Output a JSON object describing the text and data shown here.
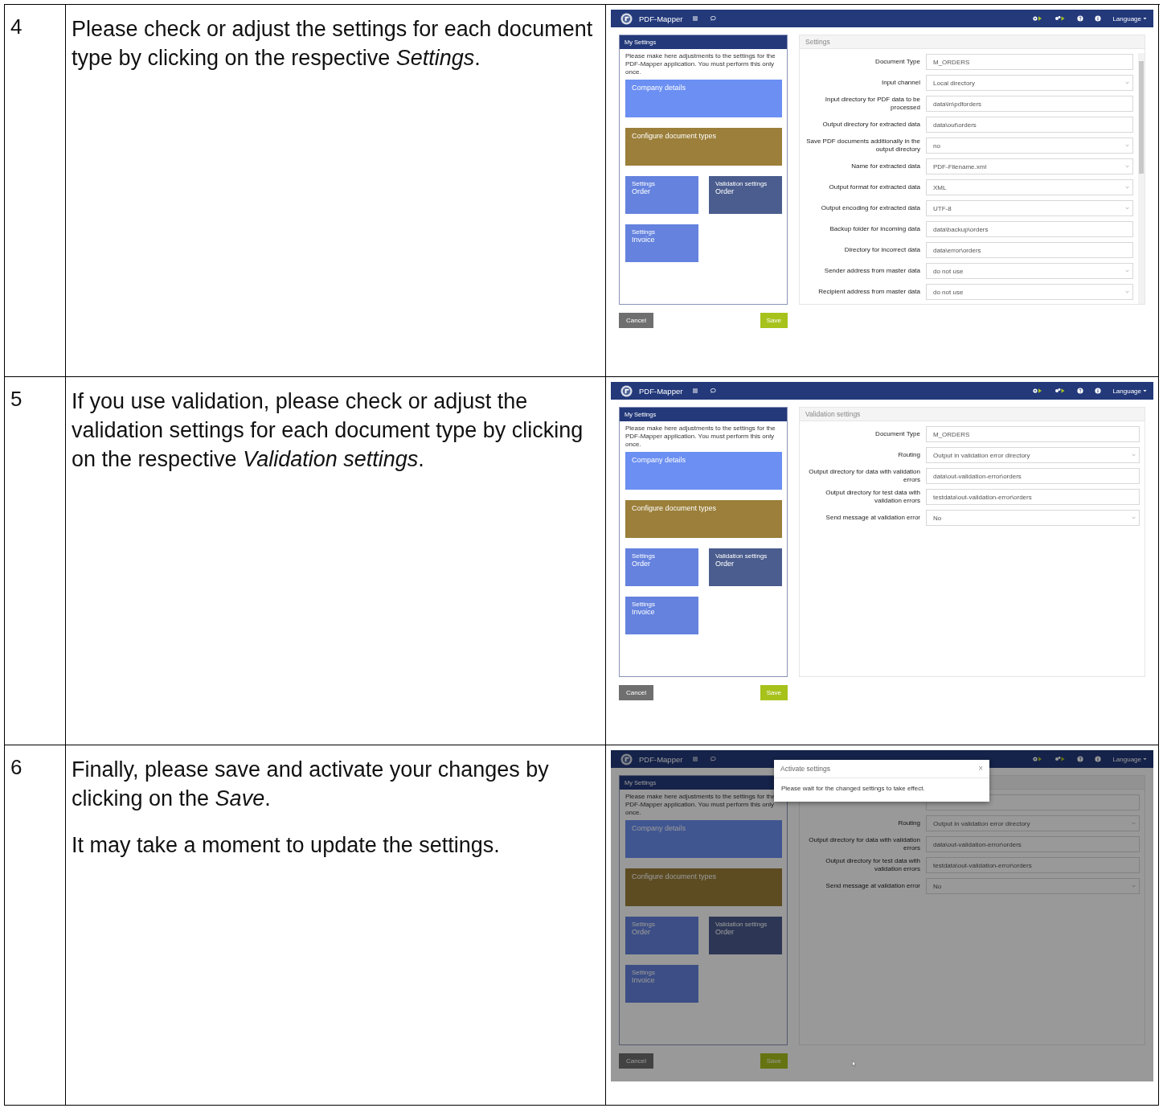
{
  "steps": [
    {
      "number": "4",
      "paragraphs": [
        "Please check or adjust the settings for each document type by clicking on the respective *Settings*."
      ],
      "screenshot": {
        "app_name": "PDF-Mapper",
        "language": "Language",
        "left_panel": {
          "title": "My Settings",
          "intro": "Please make here adjustments to the settings for the PDF-Mapper application. You must perform this only once.",
          "tiles": [
            {
              "kind": "company",
              "label": "Company details"
            },
            {
              "kind": "doctypes",
              "label": "Configure document types"
            },
            {
              "kind": "settings",
              "caption": "Settings",
              "label": "Order"
            },
            {
              "kind": "validation",
              "caption": "Validation settings",
              "label": "Order"
            },
            {
              "kind": "settings",
              "caption": "Settings",
              "label": "Invoice"
            }
          ]
        },
        "form": {
          "title": "Settings",
          "scrollbar": true,
          "rows": [
            {
              "label": "Document Type",
              "kind": "text",
              "value": "M_ORDERS"
            },
            {
              "label": "Input channel",
              "kind": "select",
              "value": "Local directory"
            },
            {
              "label": "Input directory for PDF data to be processed",
              "kind": "text",
              "value": "data\\in\\pdforders"
            },
            {
              "label": "Output directory for extracted data",
              "kind": "text",
              "value": "data\\out\\orders"
            },
            {
              "label": "Save PDF documents additionally in the output directory",
              "kind": "select",
              "value": "no"
            },
            {
              "label": "Name for extracted data",
              "kind": "select",
              "value": "PDF-Filename.xml"
            },
            {
              "label": "Output format for extracted data",
              "kind": "select",
              "value": "XML"
            },
            {
              "label": "Output encoding for extracted data",
              "kind": "select",
              "value": "UTF-8"
            },
            {
              "label": "Backup folder for incoming data",
              "kind": "text",
              "value": "data\\backup\\orders"
            },
            {
              "label": "Directory for incorrect data",
              "kind": "text",
              "value": "data\\error\\orders"
            },
            {
              "label": "Sender address from master data",
              "kind": "select",
              "value": "do not use"
            },
            {
              "label": "Recipient address from master data",
              "kind": "select",
              "value": "do not use"
            }
          ]
        },
        "buttons": [
          {
            "kind": "cancel",
            "label": "Cancel"
          },
          {
            "kind": "save",
            "label": "Save"
          }
        ]
      }
    },
    {
      "number": "5",
      "paragraphs": [
        "If you use validation, please check or adjust the validation settings for each document type by clicking on the respective *Validation settings*."
      ],
      "screenshot": {
        "app_name": "PDF-Mapper",
        "language": "Language",
        "left_panel": {
          "title": "My Settings",
          "intro": "Please make here adjustments to the settings for the PDF-Mapper application. You must perform this only once.",
          "tiles": [
            {
              "kind": "company",
              "label": "Company details"
            },
            {
              "kind": "doctypes",
              "label": "Configure document types"
            },
            {
              "kind": "settings",
              "caption": "Settings",
              "label": "Order"
            },
            {
              "kind": "validation",
              "caption": "Validation settings",
              "label": "Order"
            },
            {
              "kind": "settings",
              "caption": "Settings",
              "label": "Invoice"
            }
          ]
        },
        "form": {
          "title": "Validation settings",
          "scrollbar": false,
          "rows": [
            {
              "label": "Document Type",
              "kind": "text",
              "value": "M_ORDERS"
            },
            {
              "label": "Routing",
              "kind": "select",
              "value": "Output in validation error directory"
            },
            {
              "label": "Output directory for data with validation errors",
              "kind": "text",
              "value": "data\\out-validation-error\\orders"
            },
            {
              "label": "Output directory for test data with validation errors",
              "kind": "text",
              "value": "testdata\\out-validation-error\\orders"
            },
            {
              "label": "Send message at validation error",
              "kind": "select",
              "value": "No"
            }
          ]
        },
        "buttons": [
          {
            "kind": "cancel",
            "label": "Cancel"
          },
          {
            "kind": "save",
            "label": "Save"
          }
        ]
      }
    },
    {
      "number": "6",
      "paragraphs": [
        "Finally, please save and activate your changes by clicking on the *Save*.",
        "It may take a moment to update the settings."
      ],
      "screenshot": {
        "app_name": "PDF-Mapper",
        "language": "Language",
        "left_panel": {
          "title": "My Settings",
          "intro": "Please make here adjustments to the settings for the PDF-Mapper application. You must perform this only once.",
          "tiles": [
            {
              "kind": "company",
              "label": "Company details"
            },
            {
              "kind": "doctypes",
              "label": "Configure document types"
            },
            {
              "kind": "settings",
              "caption": "Settings",
              "label": "Order"
            },
            {
              "kind": "validation",
              "caption": "Validation settings",
              "label": "Order"
            },
            {
              "kind": "settings",
              "caption": "Settings",
              "label": "Invoice"
            }
          ]
        },
        "form": {
          "scrollbar": false,
          "rows": [
            {
              "kind": "text"
            },
            {
              "label": "Routing",
              "kind": "select",
              "value": "Output in validation error directory"
            },
            {
              "label": "Output directory for data with validation errors",
              "kind": "text",
              "value": "data\\out-validation-error\\orders"
            },
            {
              "label": "Output directory for test data with validation errors",
              "kind": "text",
              "value": "testdata\\out-validation-error\\orders"
            },
            {
              "label": "Send message at validation error",
              "kind": "select",
              "value": "No"
            }
          ]
        },
        "buttons": [
          {
            "kind": "cancel",
            "label": "Cancel"
          },
          {
            "kind": "save",
            "label": "Save"
          }
        ],
        "dialog": {
          "title": "Activate settings",
          "close": "×",
          "message": "Please wait for the changed settings to take effect."
        }
      }
    }
  ]
}
